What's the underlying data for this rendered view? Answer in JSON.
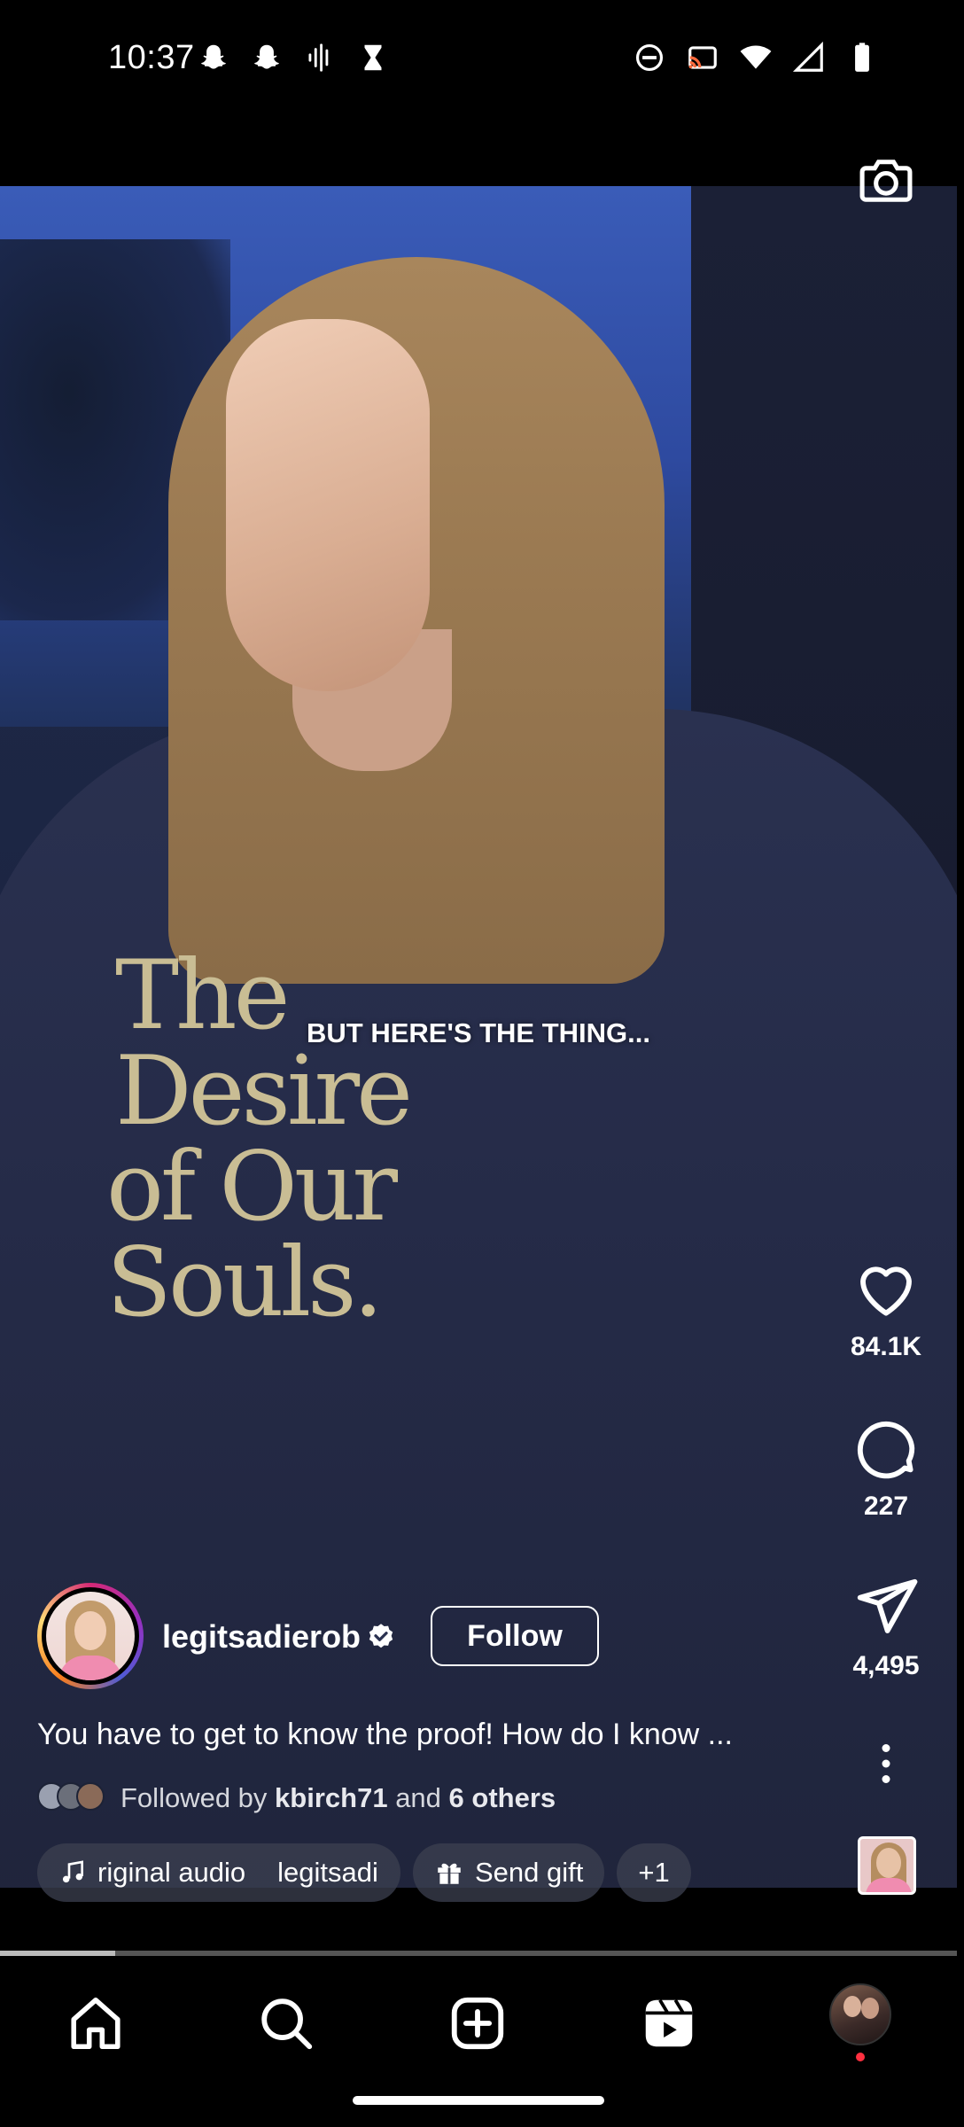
{
  "status_bar": {
    "time": "10:37",
    "left_icons": [
      "snapchat-icon",
      "snapchat-icon",
      "voice-icon",
      "hourglass-icon"
    ],
    "right_icons": [
      "do-not-disturb-icon",
      "cast-icon",
      "wifi-icon",
      "signal-icon",
      "battery-icon"
    ]
  },
  "video": {
    "caption": "BUT HERE'S THE THING...",
    "shirt_text_line1": "The Desire",
    "shirt_text_line2": "of Our Souls.",
    "progress_percent": 12
  },
  "actions": {
    "likes": "84.1K",
    "comments": "227",
    "shares": "4,495"
  },
  "author": {
    "username": "legitsadierob",
    "verified": true,
    "follow_label": "Follow"
  },
  "description": "You have to get to know the proof! How do I know ...",
  "followed_by": {
    "prefix": "Followed by",
    "user": "kbirch71",
    "connector": "and",
    "others": "6 others"
  },
  "chips": {
    "audio_label": "riginal audio",
    "audio_author": "legitsadi",
    "gift_label": "Send gift",
    "extra_label": "+1"
  },
  "nav": {
    "items": [
      "home-icon",
      "search-icon",
      "create-icon",
      "reels-icon",
      "profile-avatar"
    ]
  },
  "colors": {
    "background": "#000000",
    "notification": "#ff3040"
  }
}
